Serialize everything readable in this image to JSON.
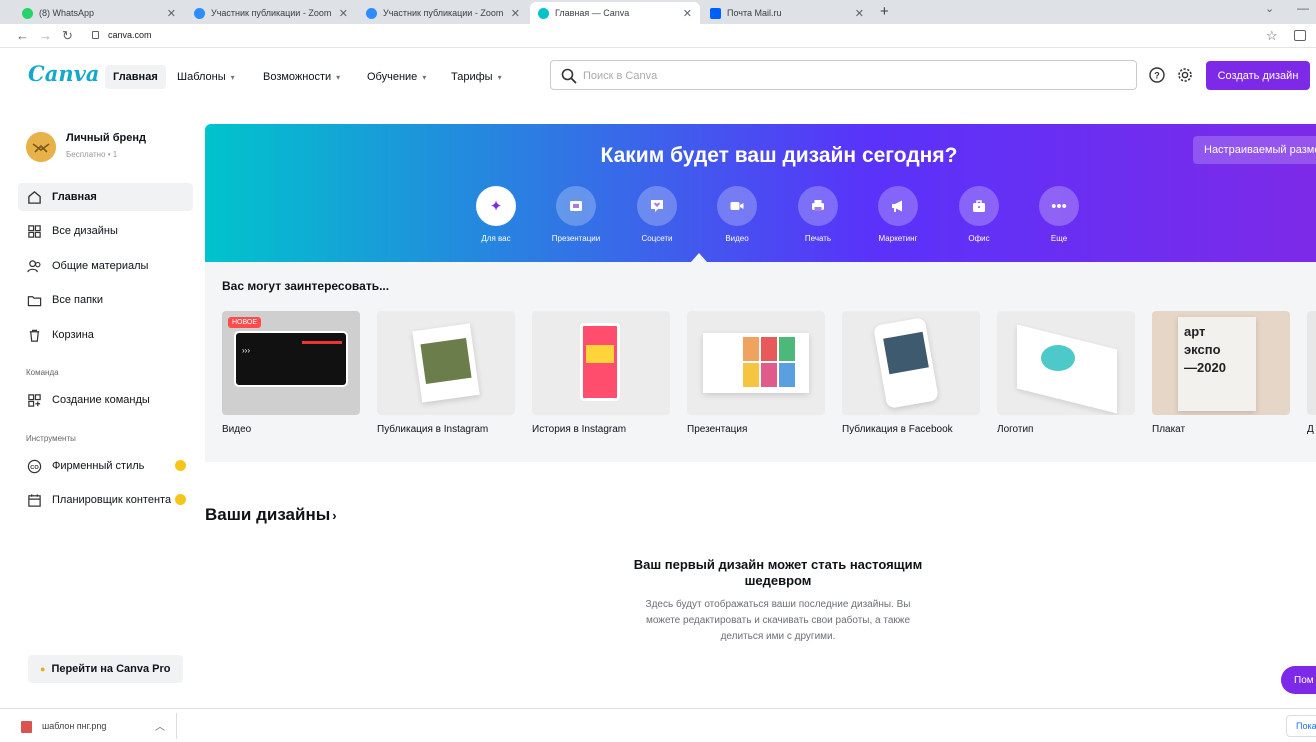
{
  "browser": {
    "tabs": [
      {
        "label": "(8) WhatsApp",
        "color": "#25d366"
      },
      {
        "label": "Участник публикации - Zoom",
        "color": "#2d8cff"
      },
      {
        "label": "Участник публикации - Zoom",
        "color": "#2d8cff"
      },
      {
        "label": "Главная — Canva",
        "color": "#00c4cc"
      },
      {
        "label": "Почта Mail.ru",
        "color": "#005ff9"
      }
    ],
    "url": "canva.com"
  },
  "header": {
    "logo": "Canva",
    "nav": [
      {
        "label": "Главная"
      },
      {
        "label": "Шаблоны"
      },
      {
        "label": "Возможности"
      },
      {
        "label": "Обучение"
      },
      {
        "label": "Тарифы"
      }
    ],
    "search_placeholder": "Поиск в Canva",
    "create_label": "Создать дизайн",
    "accent": "#7d2ae8"
  },
  "sidebar": {
    "brand_name": "Личный бренд",
    "brand_sub": "Бесплатно • 1",
    "items": [
      {
        "label": "Главная"
      },
      {
        "label": "Все дизайны"
      },
      {
        "label": "Общие материалы"
      },
      {
        "label": "Все папки"
      },
      {
        "label": "Корзина"
      }
    ],
    "team_section": "Команда",
    "team_items": [
      {
        "label": "Создание команды"
      }
    ],
    "tools_section": "Инструменты",
    "tools_items": [
      {
        "label": "Фирменный стиль"
      },
      {
        "label": "Планировщик контента"
      }
    ],
    "pro_label": "Перейти на Canva Pro"
  },
  "hero": {
    "title": "Каким будет ваш дизайн сегодня?",
    "custom_label": "Настраиваемый размер",
    "categories": [
      {
        "label": "Для вас"
      },
      {
        "label": "Презентации"
      },
      {
        "label": "Соцсети"
      },
      {
        "label": "Видео"
      },
      {
        "label": "Печать"
      },
      {
        "label": "Маркетинг"
      },
      {
        "label": "Офис"
      },
      {
        "label": "Еще"
      }
    ]
  },
  "recommend": {
    "title": "Вас могут заинтересовать...",
    "new_badge": "НОВОЕ",
    "cards": [
      {
        "label": "Видео"
      },
      {
        "label": "Публикация в Instagram"
      },
      {
        "label": "История в Instagram"
      },
      {
        "label": "Презентация"
      },
      {
        "label": "Публикация в Facebook"
      },
      {
        "label": "Логотип"
      },
      {
        "label": "Плакат"
      },
      {
        "label": "Д"
      }
    ],
    "poster_lines": [
      "арт",
      "экспо",
      "—2020"
    ]
  },
  "designs": {
    "title": "Ваши дизайны",
    "empty_title": "Ваш первый дизайн может стать настоящим шедевром",
    "empty_text": "Здесь будут отображаться ваши последние дизайны. Вы можете редактировать и скачивать свои работы, а также делиться ими с другими.",
    "help_label": "Пом"
  },
  "downloads": {
    "file": "шаблон пнг.png",
    "show_all": "Пока"
  }
}
